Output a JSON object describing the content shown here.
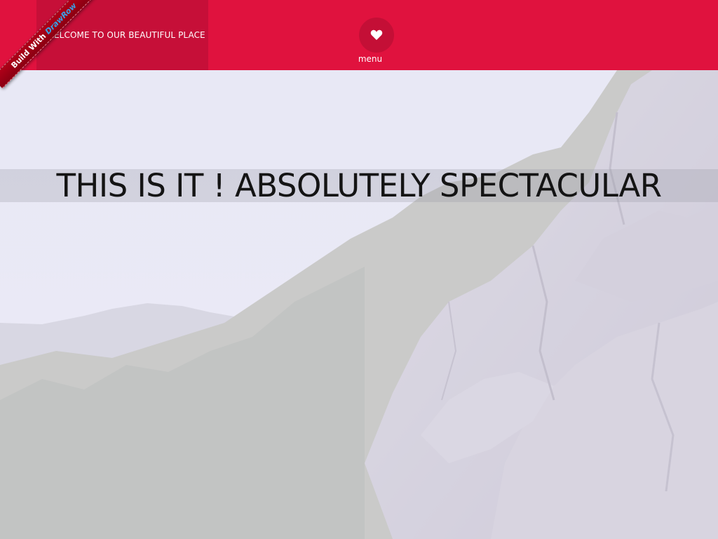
{
  "header": {
    "welcome_text": "ELCOME TO OUR BEAUTIFUL PLACE",
    "menu_icon": "heart-icon",
    "menu_label": "menu"
  },
  "ribbon": {
    "prefix": "Build With",
    "brand_part1": "Draw",
    "brand_part2": "Row"
  },
  "hero": {
    "headline": "THIS IS IT ! ABSOLUTELY SPECTACULAR",
    "background_image": "mountain-cliff-landscape"
  },
  "colors": {
    "header_bg": "#e0123e",
    "welcome_box_bg": "#c60f38",
    "menu_button_bg": "#c40f36",
    "ribbon_bg": "#9c0016",
    "ribbon_brand": "#3aa1e6",
    "headline_text": "#141414"
  }
}
